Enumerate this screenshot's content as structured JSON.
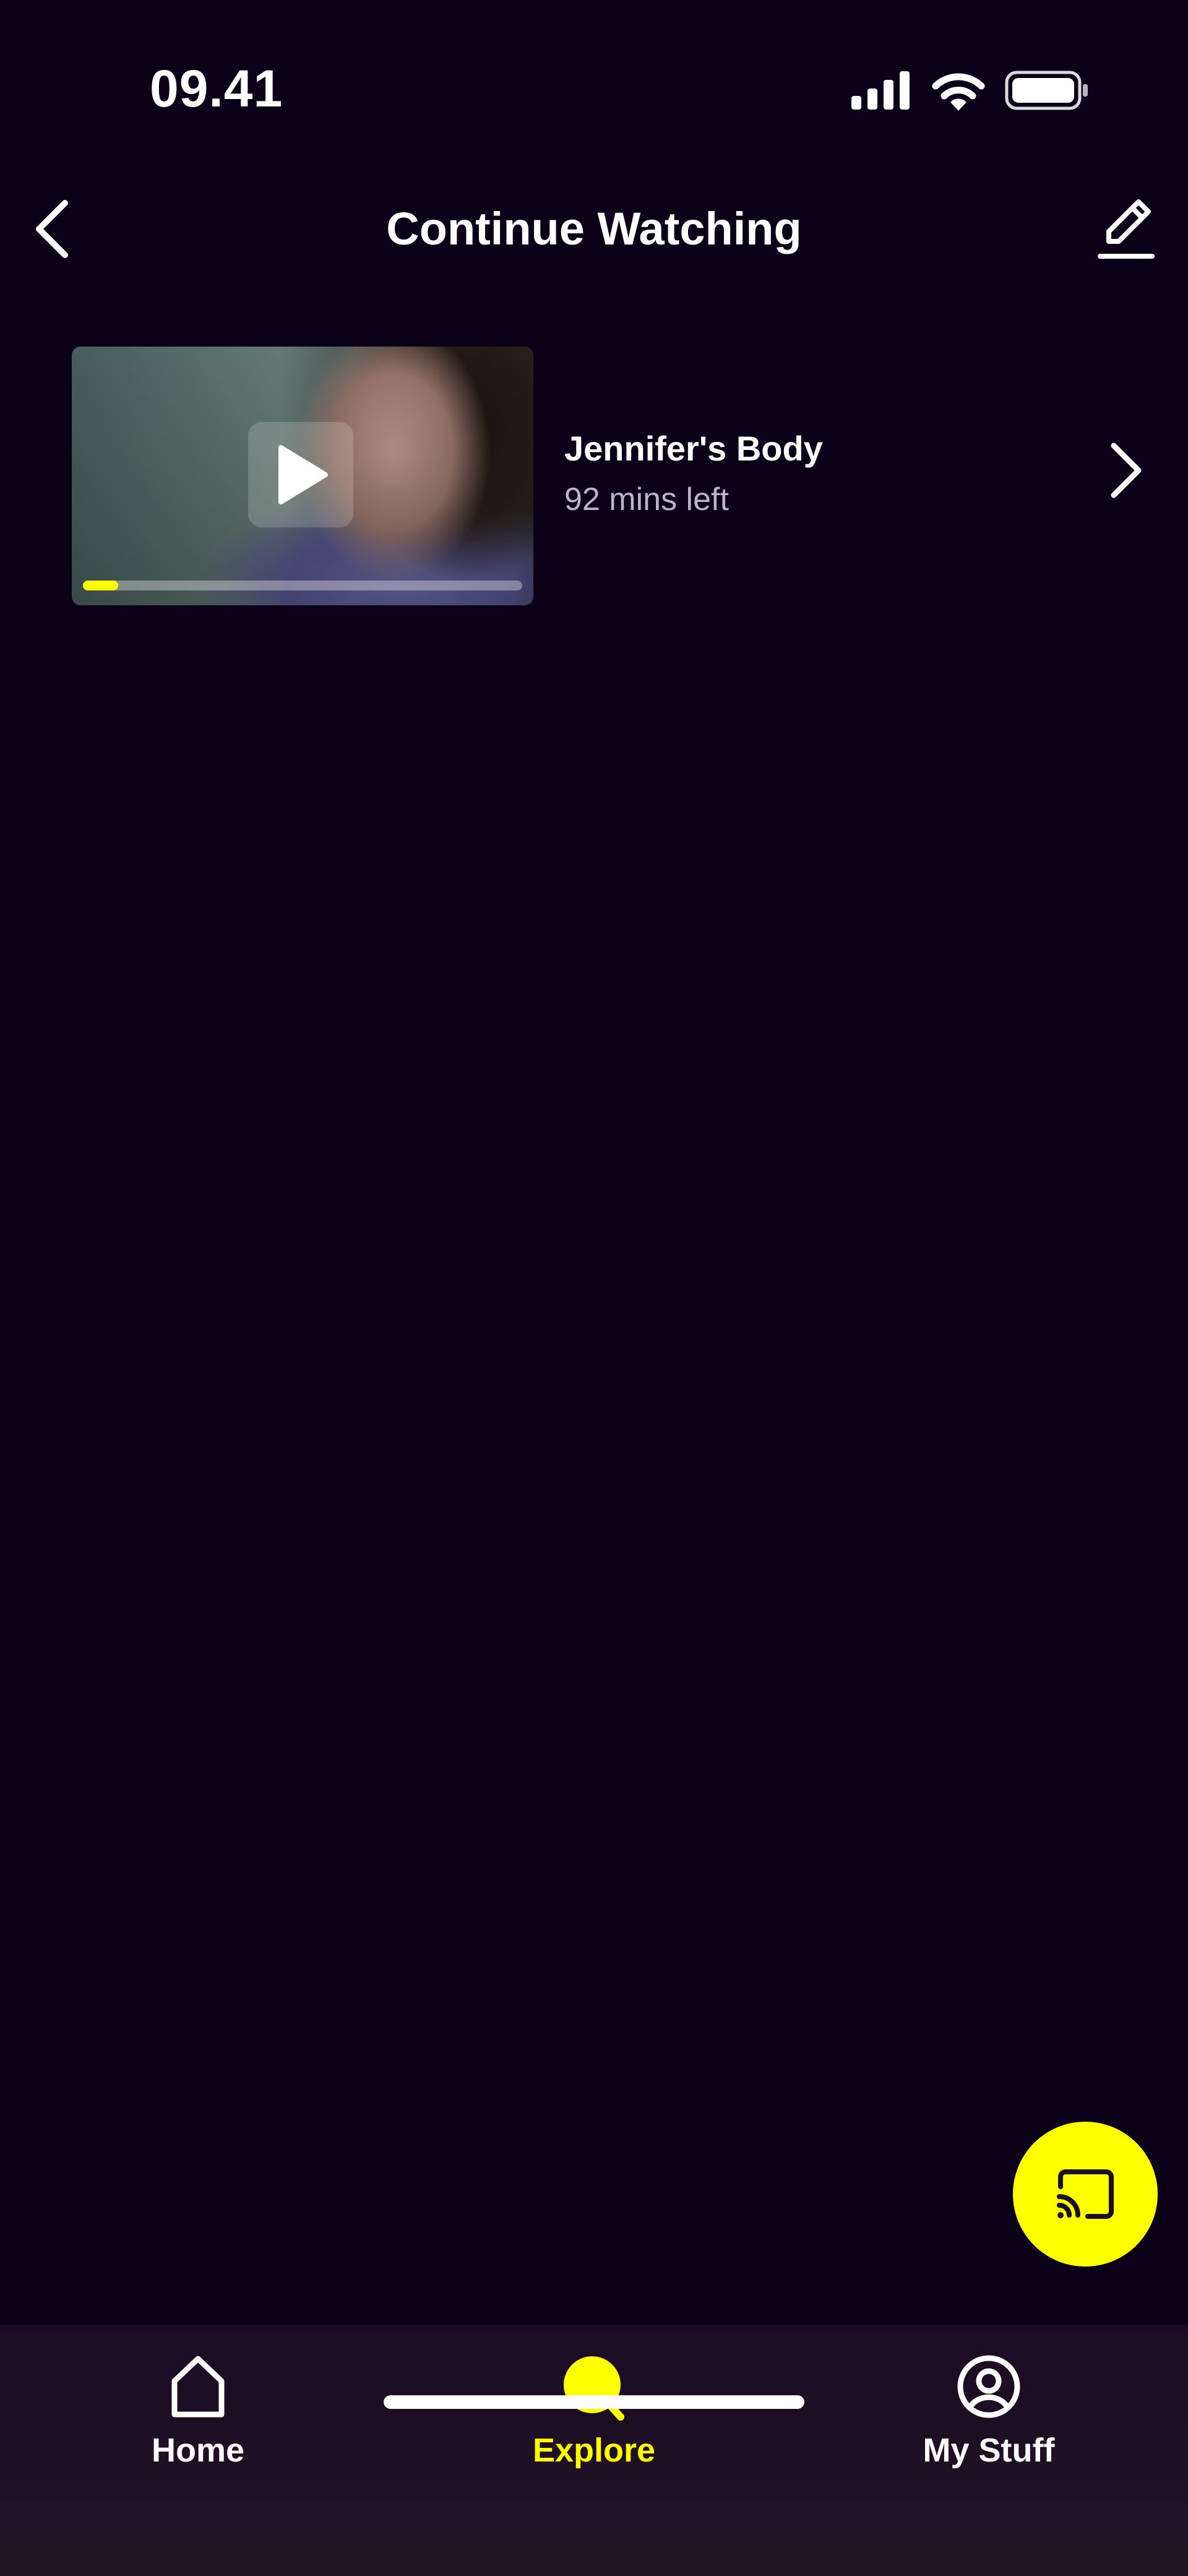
{
  "status_bar": {
    "time": "09.41",
    "icons": [
      "signal-icon",
      "wifi-icon",
      "battery-icon"
    ]
  },
  "header": {
    "title": "Continue Watching",
    "back_icon": "chevron-left-icon",
    "edit_icon": "pencil-icon"
  },
  "continue_watching": [
    {
      "title": "Jennifer's Body",
      "subtitle": "92 mins left",
      "progress": 0.08,
      "play_icon": "play-icon",
      "chevron_icon": "chevron-right-icon"
    }
  ],
  "cast_button": {
    "icon": "cast-icon"
  },
  "bottom_nav": {
    "items": [
      {
        "label": "Home",
        "icon": "home-icon",
        "active": false
      },
      {
        "label": "Explore",
        "icon": "search-icon",
        "active": true
      },
      {
        "label": "My Stuff",
        "icon": "user-circle-icon",
        "active": false
      }
    ]
  },
  "colors": {
    "background": "#0a0018",
    "accent": "#ffff00",
    "text_primary": "#ffffff",
    "text_secondary": "#b9b4c6",
    "nav_background": "#1f1024"
  }
}
